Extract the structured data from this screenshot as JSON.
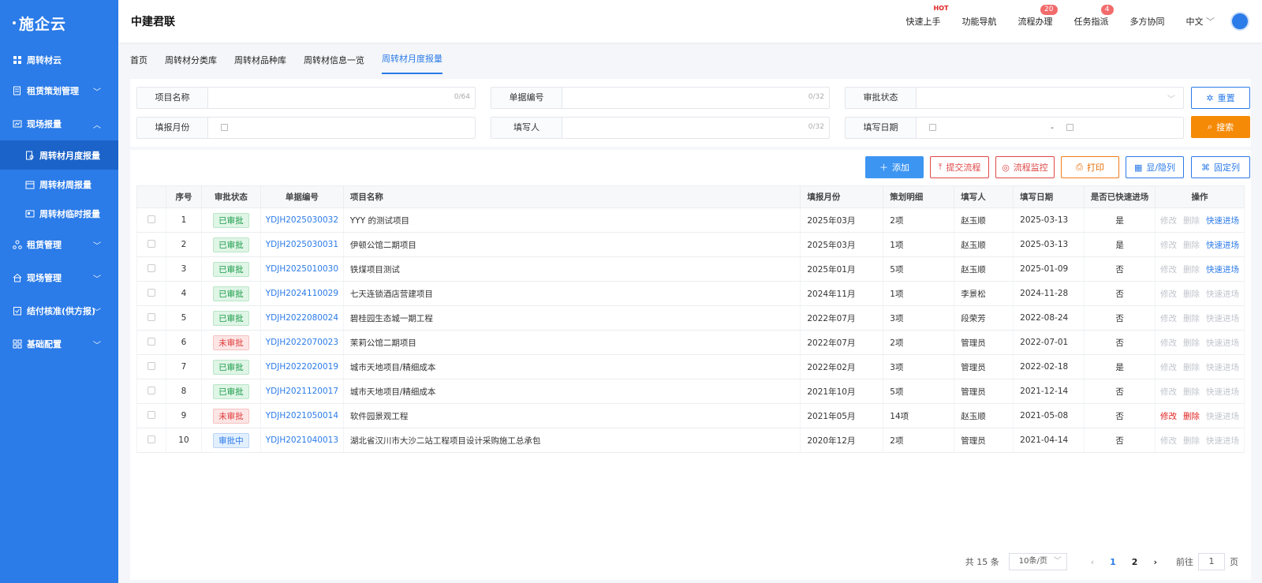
{
  "app": {
    "logo": "施企云",
    "company": "中建君联"
  },
  "topnav": [
    {
      "label": "快速上手",
      "badge": "",
      "hot": true
    },
    {
      "label": "功能导航",
      "badge": "",
      "hot": false
    },
    {
      "label": "流程办理",
      "badge": "20",
      "hot": false
    },
    {
      "label": "任务指派",
      "badge": "4",
      "hot": false
    },
    {
      "label": "多方协同",
      "badge": "",
      "hot": false
    },
    {
      "label": "中文",
      "badge": "",
      "hot": false
    }
  ],
  "hot_label": "HOT",
  "sidebar": {
    "items": [
      {
        "label": "周转材云"
      },
      {
        "label": "租赁策划管理"
      },
      {
        "label": "现场报量"
      },
      {
        "label": "租赁管理"
      },
      {
        "label": "现场管理"
      },
      {
        "label": "结付核准(供方报)"
      },
      {
        "label": "基础配置"
      }
    ],
    "sub": [
      {
        "label": "周转材月度报量"
      },
      {
        "label": "周转材周报量"
      },
      {
        "label": "周转材临时报量"
      }
    ]
  },
  "tabs": [
    "首页",
    "周转材分类库",
    "周转材品种库",
    "周转材信息一览",
    "周转材月度报量"
  ],
  "filter": {
    "project": {
      "label": "项目名称",
      "count": "0/64"
    },
    "doc_no": {
      "label": "单据编号",
      "count": "0/32"
    },
    "status": {
      "label": "审批状态"
    },
    "month": {
      "label": "填报月份"
    },
    "filler": {
      "label": "填写人",
      "count": "0/32"
    },
    "date": {
      "label": "填写日期",
      "sep": "-"
    },
    "reset": "重置",
    "search": "搜索"
  },
  "actions": {
    "add": "添加",
    "submit": "提交流程",
    "monitor": "流程监控",
    "print": "打印",
    "toggle_cols": "显/隐列",
    "fix_cols": "固定列"
  },
  "table": {
    "headers": [
      "序号",
      "审批状态",
      "单据编号",
      "项目名称",
      "填报月份",
      "策划明细",
      "填写人",
      "填写日期",
      "是否已快速进场",
      "操作"
    ],
    "ops": {
      "edit": "修改",
      "delete": "删除",
      "quick": "快速进场"
    },
    "rows": [
      {
        "no": "1",
        "status": "已审批",
        "code": "YDJH2025030032",
        "project": "YYY 的测试项目",
        "month": "2025年03月",
        "detail": "2项",
        "filler": "赵玉顺",
        "date": "2025-03-13",
        "quick": "是",
        "state": "ok",
        "opmode": "quick"
      },
      {
        "no": "2",
        "status": "已审批",
        "code": "YDJH2025030031",
        "project": "伊顿公馆二期项目",
        "month": "2025年03月",
        "detail": "1项",
        "filler": "赵玉顺",
        "date": "2025-03-13",
        "quick": "是",
        "state": "ok",
        "opmode": "quick"
      },
      {
        "no": "3",
        "status": "已审批",
        "code": "YDJH2025010030",
        "project": "铁煤项目测试",
        "month": "2025年01月",
        "detail": "5项",
        "filler": "赵玉顺",
        "date": "2025-01-09",
        "quick": "否",
        "state": "ok",
        "opmode": "quick"
      },
      {
        "no": "4",
        "status": "已审批",
        "code": "YDJH2024110029",
        "project": "七天连锁酒店营建项目",
        "month": "2024年11月",
        "detail": "1项",
        "filler": "李景松",
        "date": "2024-11-28",
        "quick": "否",
        "state": "ok",
        "opmode": "none"
      },
      {
        "no": "5",
        "status": "已审批",
        "code": "YDJH2022080024",
        "project": "碧桂园生态城一期工程",
        "month": "2022年07月",
        "detail": "3项",
        "filler": "段荣芳",
        "date": "2022-08-24",
        "quick": "否",
        "state": "ok",
        "opmode": "none"
      },
      {
        "no": "6",
        "status": "未审批",
        "code": "YDJH2022070023",
        "project": "茉莉公馆二期项目",
        "month": "2022年07月",
        "detail": "2项",
        "filler": "管理员",
        "date": "2022-07-01",
        "quick": "否",
        "state": "no",
        "opmode": "none"
      },
      {
        "no": "7",
        "status": "已审批",
        "code": "YDJH2022020019",
        "project": "城市天地项目/精细成本",
        "month": "2022年02月",
        "detail": "3项",
        "filler": "管理员",
        "date": "2022-02-18",
        "quick": "是",
        "state": "ok",
        "opmode": "none"
      },
      {
        "no": "8",
        "status": "已审批",
        "code": "YDJH2021120017",
        "project": "城市天地项目/精细成本",
        "month": "2021年10月",
        "detail": "5项",
        "filler": "管理员",
        "date": "2021-12-14",
        "quick": "否",
        "state": "ok",
        "opmode": "none"
      },
      {
        "no": "9",
        "status": "未审批",
        "code": "YDJH2021050014",
        "project": "软件园景观工程",
        "month": "2021年05月",
        "detail": "14项",
        "filler": "赵玉顺",
        "date": "2021-05-08",
        "quick": "否",
        "state": "no",
        "opmode": "edit"
      },
      {
        "no": "10",
        "status": "审批中",
        "code": "YDJH2021040013",
        "project": "湖北省汉川市大沙二站工程项目设计采购施工总承包",
        "month": "2020年12月",
        "detail": "2项",
        "filler": "管理员",
        "date": "2021-04-14",
        "quick": "否",
        "state": "ing",
        "opmode": "none"
      }
    ]
  },
  "pager": {
    "total": "共 15 条",
    "size": "10条/页",
    "prev": "‹",
    "next": "›",
    "pages": [
      "1",
      "2"
    ],
    "goto_pre": "前往",
    "goto_val": "1",
    "goto_post": "页"
  },
  "colors": {
    "primary": "#2b7be8",
    "orange": "#f58a07",
    "danger": "#e04848",
    "success": "#1c9c4a"
  }
}
